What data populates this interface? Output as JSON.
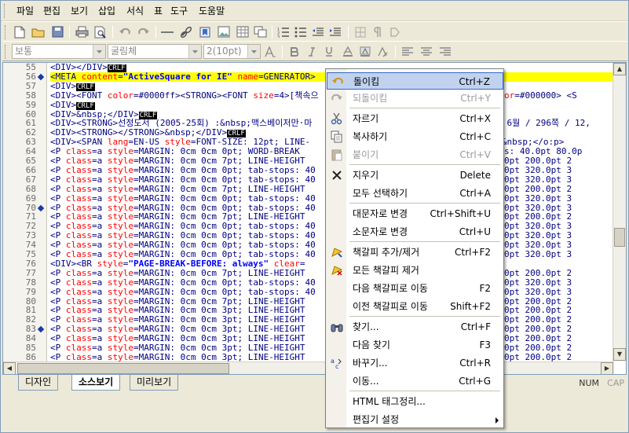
{
  "menubar": {
    "items": [
      "파일",
      "편집",
      "보기",
      "삽입",
      "서식",
      "표",
      "도구",
      "도움말"
    ]
  },
  "format_toolbar": {
    "style_value": "보통",
    "font_value": "굴림체",
    "size_value": "2(10pt)"
  },
  "editor": {
    "line_numbers": [
      "55",
      "56",
      "57",
      "58",
      "59",
      "60",
      "61",
      "62",
      "63",
      "64",
      "65",
      "66",
      "67",
      "68",
      "69",
      "70",
      "71",
      "72",
      "73",
      "74",
      "75",
      "76",
      "77",
      "78",
      "79",
      "80",
      "81",
      "82",
      "83",
      "84",
      "85",
      "86"
    ],
    "bookmarked_lines": [
      "56",
      "70",
      "83"
    ],
    "highlighted_line": "56",
    "lines": [
      "<DIV></DIV>CRLF",
      "<META content=\"ActiveSquare for IE\" name=GENERATOR>",
      "<DIV>CRLF",
      "<DIV><FONT color=#0000ff><STRONG><FONT size=4>[책속으",
      "<DIV>CRLF",
      "<DIV>&nbsp;</DIV>CRLF",
      "<DIV><STRONG>선정도서 (2005-25회) :&nbsp;맥스베이저만·마",
      "<DIV><STRONG></STRONG>&nbsp;</DIV>CRLF",
      "<DIV><SPAN lang=EN-US style=\"FONT-SIZE: 12pt; LINE-",
      "<P class=a style=\"MARGIN: 0cm 0cm 0pt; WORD-BREAK",
      "<P class=a style=\"MARGIN: 0cm 0cm 7pt; LINE-HEIGHT",
      "<P class=a style=\"MARGIN: 0cm 0cm 0pt; tab-stops: 40",
      "<P class=a style=\"MARGIN: 0cm 0cm 0pt; tab-stops: 40",
      "<P class=a style=\"MARGIN: 0cm 0cm 7pt; LINE-HEIGHT",
      "<P class=a style=\"MARGIN: 0cm 0cm 0pt; tab-stops: 40",
      "<P class=a style=\"MARGIN: 0cm 0cm 0pt; tab-stops: 40",
      "<P class=a style=\"MARGIN: 0cm 0cm 7pt; LINE-HEIGHT",
      "<P class=a style=\"MARGIN: 0cm 0cm 0pt; tab-stops: 40",
      "<P class=a style=\"MARGIN: 0cm 0cm 0pt; tab-stops: 40",
      "<P class=a style=\"MARGIN: 0cm 0cm 0pt; tab-stops: 40",
      "<P class=a style=\"MARGIN: 0cm 0cm 0pt; tab-stops: 40",
      "<DIV><BR style=\"PAGE-BREAK-BEFORE: always\" clear=",
      "<P class=a style=\"MARGIN: 0cm 0cm 7pt; LINE-HEIGHT",
      "<P class=a style=\"MARGIN: 0cm 0cm 0pt; tab-stops: 40",
      "<P class=a style=\"MARGIN: 0cm 0cm 0pt; tab-stops: 40",
      "<P class=a style=\"MARGIN: 0cm 0cm 7pt; LINE-HEIGHT",
      "<P class=a style=\"MARGIN: 0cm 0cm 3pt; LINE-HEIGHT",
      "<P class=a style=\"MARGIN: 0cm 0cm 3pt; LINE-HEIGHT",
      "<P class=a style=\"MARGIN: 0cm 0cm 3pt; LINE-HEIGHT",
      "<P class=a style=\"MARGIN: 0cm 0cm 3pt; LINE-HEIGHT",
      "<P class=a style=\"MARGIN: 0cm 0cm 3pt; LINE-HEIGHT",
      "<P class=a style=\"MARGIN: 0cm 0cm 3pt; LINE-HEIGHT"
    ],
    "right_fragments": [
      "",
      "",
      "",
      "FONT color=#000000> <S",
      "",
      "",
      "/ 2005년 6월 / 296쪽 / 12,",
      "",
      "제\"><o:p>&nbsp;</o:p>",
      "tab-stops: 40.0pt 80.0p",
      "0pt 160.0pt 200.0pt 2",
      "0pt 280.0pt 320.0pt 3",
      "0pt 280.0pt 320.0pt 3",
      "0pt 160.0pt 200.0pt 2",
      "0pt 280.0pt 320.0pt 3",
      "0pt 280.0pt 320.0pt 3",
      "0pt 160.0pt 200.0pt 2",
      "0pt 280.0pt 320.0pt 3",
      "0pt 280.0pt 320.0pt 3",
      "0pt 280.0pt 320.0pt 3",
      "0pt 280.0pt 320.0pt 3",
      "",
      "0pt 160.0pt 200.0pt 2",
      "0pt 280.0pt 320.0pt 3",
      "0pt 280.0pt 320.0pt 3",
      "0pt 160.0pt 200.0pt 2",
      "0pt 160.0pt 200.0pt 2",
      "0pt 160.0pt 200.0pt 2",
      "0pt 160.0pt 200.0pt 2",
      "0pt 160.0pt 200.0pt 2",
      "0pt 160.0pt 200.0pt 2",
      "0pt 160.0pt 200.0pt 2"
    ]
  },
  "tabs": [
    "디자인",
    "소스보기",
    "미리보기"
  ],
  "active_tab": "소스보기",
  "status": {
    "num": "NUM",
    "cap": "CAP"
  },
  "context_menu": {
    "items": [
      {
        "label": "돌이킴",
        "shortcut": "Ctrl+Z",
        "icon": "undo-icon",
        "disabled": false,
        "selected": true
      },
      {
        "label": "되돌이킴",
        "shortcut": "Ctrl+Y",
        "icon": "redo-icon",
        "disabled": true
      },
      {
        "label": "자르기",
        "shortcut": "Ctrl+X",
        "icon": "scissors-icon",
        "disabled": false
      },
      {
        "label": "복사하기",
        "shortcut": "Ctrl+C",
        "icon": "copy-icon",
        "disabled": false
      },
      {
        "label": "붙이기",
        "shortcut": "Ctrl+V",
        "icon": "paste-icon",
        "disabled": true
      },
      {
        "label": "지우기",
        "shortcut": "Delete",
        "icon": "delete-icon",
        "disabled": false
      },
      {
        "label": "모두 선택하기",
        "shortcut": "Ctrl+A",
        "icon": "",
        "disabled": false
      },
      {
        "label": "대문자로 변경",
        "shortcut": "Ctrl+Shift+U",
        "icon": "",
        "disabled": false
      },
      {
        "label": "소문자로 변경",
        "shortcut": "Ctrl+U",
        "icon": "",
        "disabled": false
      },
      {
        "label": "책갈피 추가/제거",
        "shortcut": "Ctrl+F2",
        "icon": "bookmark-toggle-icon",
        "disabled": false
      },
      {
        "label": "모든 책갈피 제거",
        "shortcut": "",
        "icon": "bookmark-clear-icon",
        "disabled": false
      },
      {
        "label": "다음 책갈피로 이동",
        "shortcut": "F2",
        "icon": "",
        "disabled": false
      },
      {
        "label": "이전 책갈피로 이동",
        "shortcut": "Shift+F2",
        "icon": "",
        "disabled": false
      },
      {
        "label": "찾기...",
        "shortcut": "Ctrl+F",
        "icon": "binoculars-icon",
        "disabled": false
      },
      {
        "label": "다음 찾기",
        "shortcut": "F3",
        "icon": "",
        "disabled": false
      },
      {
        "label": "바꾸기...",
        "shortcut": "Ctrl+R",
        "icon": "replace-icon",
        "disabled": false
      },
      {
        "label": "이동...",
        "shortcut": "Ctrl+G",
        "icon": "",
        "disabled": false
      },
      {
        "label": "HTML 태그정리...",
        "shortcut": "",
        "icon": "",
        "disabled": false
      },
      {
        "label": "편집기 설정",
        "shortcut": "",
        "icon": "",
        "disabled": false,
        "submenu": true
      }
    ]
  },
  "colors": {
    "tag": "#000080",
    "attribute": "#ff0000",
    "value": "#0000ff",
    "line_highlight": "#ffff00",
    "menu_selection": "#c1d2ee"
  }
}
